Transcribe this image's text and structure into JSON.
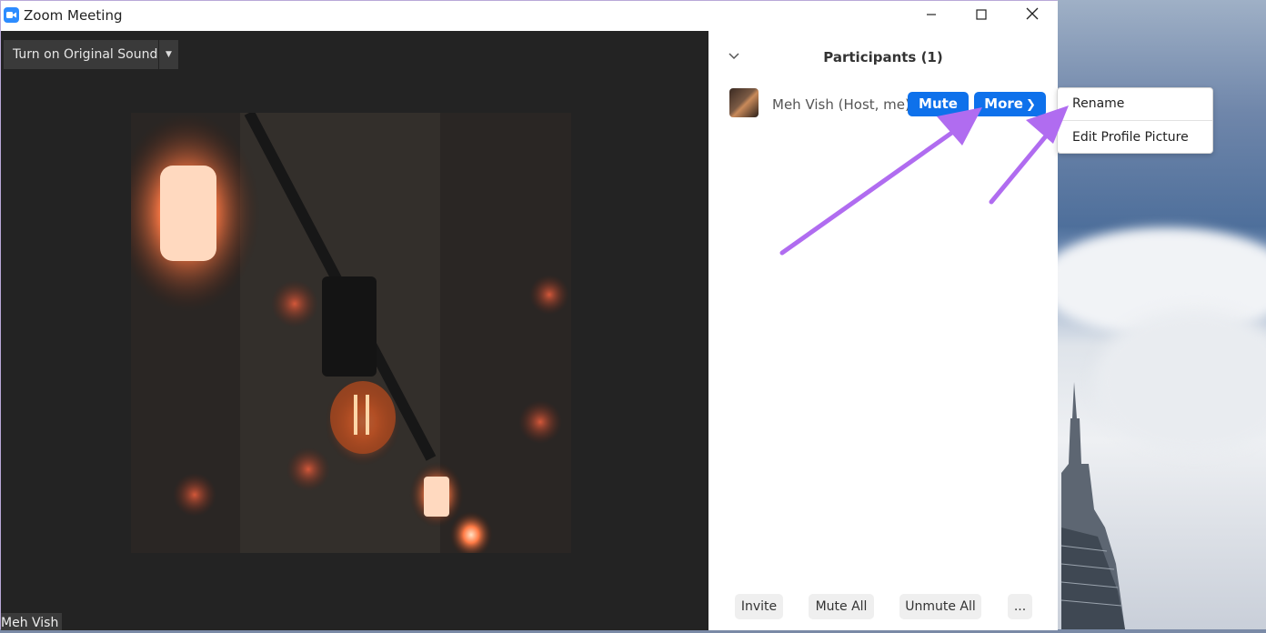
{
  "window": {
    "title": "Zoom Meeting"
  },
  "video": {
    "sound_button": "Turn on Original Sound",
    "name_tag": "Meh Vish"
  },
  "participants": {
    "title": "Participants (1)",
    "rows": [
      {
        "name": "Meh Vish (Host, me)",
        "mute_label": "Mute",
        "more_label": "More"
      }
    ]
  },
  "menu": {
    "items": [
      "Rename",
      "Edit Profile Picture"
    ]
  },
  "footer": {
    "invite": "Invite",
    "mute_all": "Mute All",
    "unmute_all": "Unmute All",
    "ellipsis": "..."
  },
  "colors": {
    "accent": "#0e71eb",
    "annotation_arrow": "#b06cf0"
  }
}
